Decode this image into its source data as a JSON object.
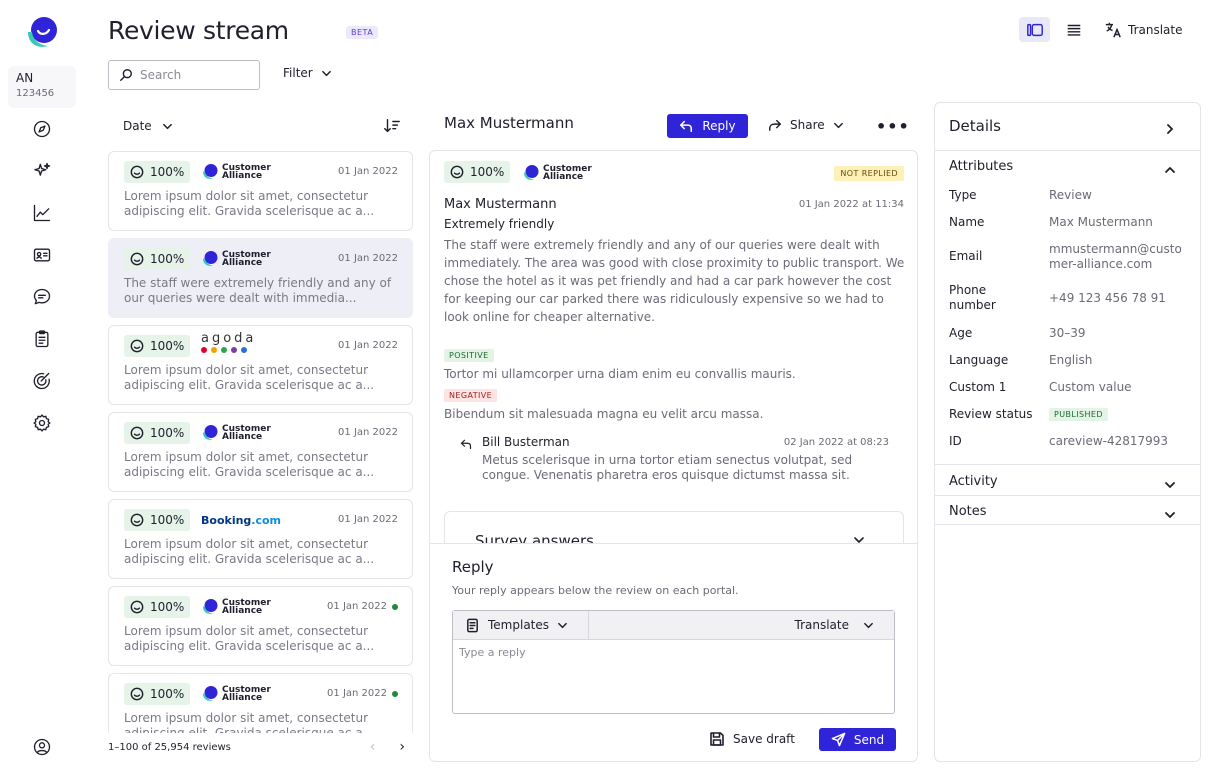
{
  "app": {
    "title": "Review stream",
    "badge": "BETA"
  },
  "account": {
    "initials": "AN",
    "id": "123456"
  },
  "toolbar": {
    "translate_label": "Translate"
  },
  "search": {
    "placeholder": "Search",
    "value": ""
  },
  "filter": {
    "label": "Filter"
  },
  "list": {
    "sort_label": "Date",
    "footer": "1–100 of 25,954 reviews",
    "items": [
      {
        "score": "100%",
        "source": "Customer Alliance",
        "date": "01 Jan 2022",
        "snippet": "Lorem ipsum dolor sit amet, consectetur adipiscing elit. Gravida scelerisque ac a...",
        "selected": false,
        "unread": false
      },
      {
        "score": "100%",
        "source": "Customer Alliance",
        "date": "01 Jan 2022",
        "snippet": "The staff were extremely friendly and any of our queries were dealt with immedia...",
        "selected": true,
        "unread": false
      },
      {
        "score": "100%",
        "source": "agoda",
        "date": "01 Jan 2022",
        "snippet": "Lorem ipsum dolor sit amet, consectetur adipiscing elit. Gravida scelerisque ac a...",
        "selected": false,
        "unread": false
      },
      {
        "score": "100%",
        "source": "Customer Alliance",
        "date": "01 Jan 2022",
        "snippet": "Lorem ipsum dolor sit amet, consectetur adipiscing elit. Gravida scelerisque ac a...",
        "selected": false,
        "unread": false
      },
      {
        "score": "100%",
        "source": "Booking.com",
        "date": "01 Jan 2022",
        "snippet": "Lorem ipsum dolor sit amet, consectetur adipiscing elit. Gravida scelerisque ac a...",
        "selected": false,
        "unread": false
      },
      {
        "score": "100%",
        "source": "Customer Alliance",
        "date": "01 Jan 2022",
        "snippet": "Lorem ipsum dolor sit amet, consectetur adipiscing elit. Gravida scelerisque ac a...",
        "selected": false,
        "unread": true
      },
      {
        "score": "100%",
        "source": "Customer Alliance",
        "date": "01 Jan 2022",
        "snippet": "Lorem ipsum dolor sit amet, consectetur adipiscing elit. Gravida scelerisque ac a...",
        "selected": false,
        "unread": true
      }
    ]
  },
  "review": {
    "header_name": "Max Mustermann",
    "reply_label": "Reply",
    "share_label": "Share",
    "score": "100%",
    "source": "Customer Alliance",
    "status": "NOT REPLIED",
    "author": "Max Mustermann",
    "date": "01 Jan 2022 at 11:34",
    "title": "Extremely friendly",
    "body": "The staff were extremely friendly and any of our queries were dealt with immediately. The area was good with close proximity to public transport. We chose the hotel as it was pet friendly and had a car park however the cost for keeping our car parked there was ridiculously expensive so we had to look online for cheaper alternative.",
    "positive_tag": "POSITIVE",
    "positive_text": "Tortor mi ullamcorper urna diam enim eu convallis mauris.",
    "negative_tag": "NEGATIVE",
    "negative_text": "Bibendum sit malesuada magna eu velit arcu massa.",
    "response": {
      "author": "Bill Busterman",
      "date": "02 Jan 2022 at 08:23",
      "body": "Metus scelerisque in urna tortor etiam senectus volutpat, sed congue. Venenatis pharetra eros quisque dictumst massa sit."
    },
    "survey_label": "Survey answers"
  },
  "reply_box": {
    "title": "Reply",
    "subtitle": "Your reply appears below the review on each portal.",
    "templates_label": "Templates",
    "translate_label": "Translate",
    "placeholder": "Type a reply",
    "save_label": "Save draft",
    "send_label": "Send"
  },
  "details": {
    "title": "Details",
    "attributes_label": "Attributes",
    "attributes": [
      {
        "key": "Type",
        "value": "Review"
      },
      {
        "key": "Name",
        "value": "Max Mustermann"
      },
      {
        "key": "Email",
        "value": "mmustermann@customer-alliance.com"
      },
      {
        "key": "Phone number",
        "value": "+49 123 456 78 91"
      },
      {
        "key": "Age",
        "value": "30–39"
      },
      {
        "key": "Language",
        "value": "English"
      },
      {
        "key": "Custom 1",
        "value": "Custom value"
      },
      {
        "key": "Review status",
        "value": "PUBLISHED"
      },
      {
        "key": "ID",
        "value": "careview-42817993"
      }
    ],
    "activity_label": "Activity",
    "notes_label": "Notes"
  },
  "colors": {
    "accent": "#2f24d8",
    "score_bg": "#e5f3e8",
    "selected_bg": "#eeeef6"
  }
}
